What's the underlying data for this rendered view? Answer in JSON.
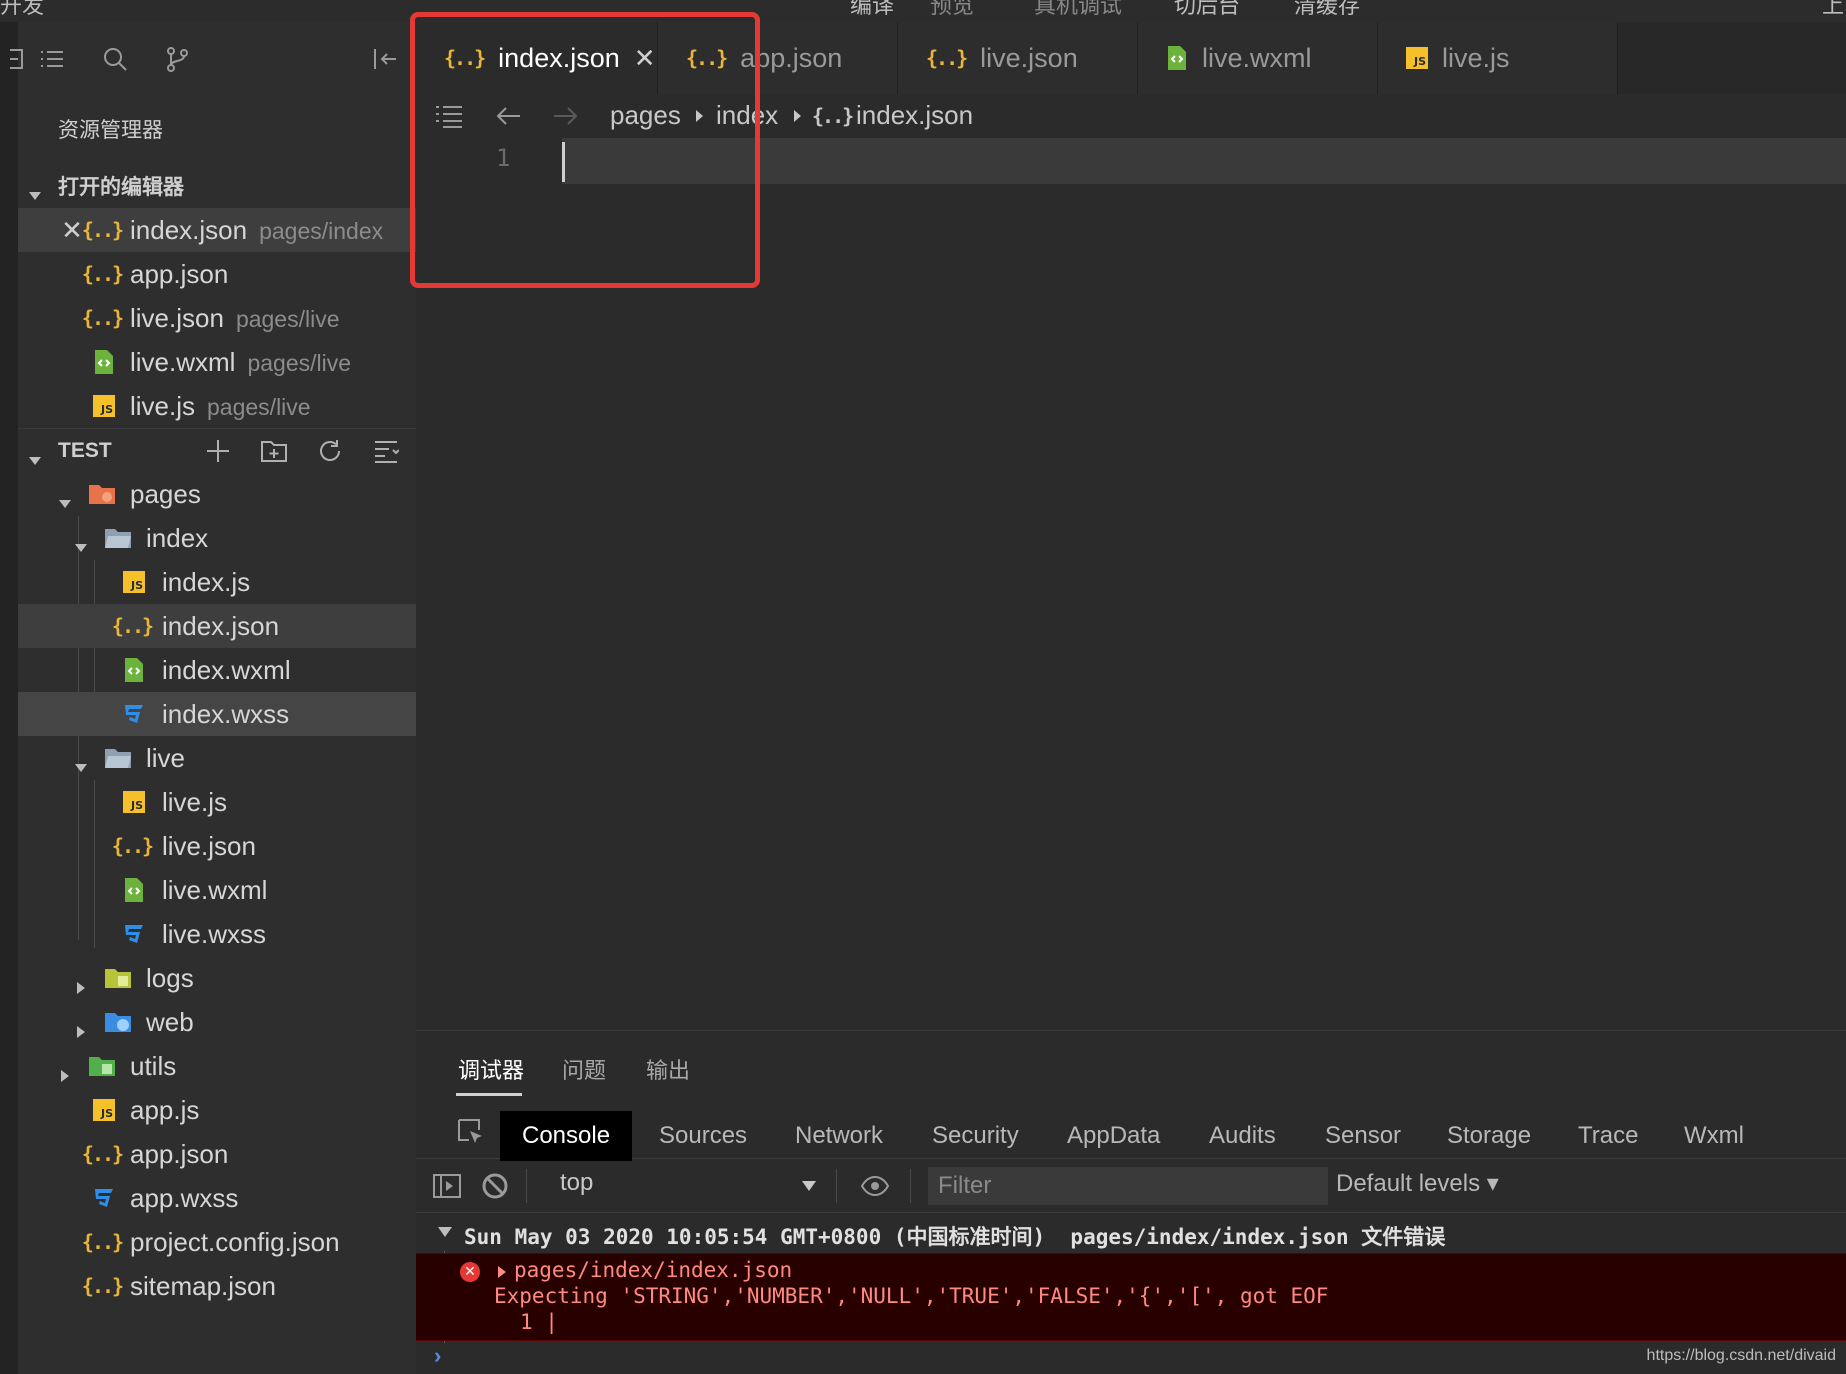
{
  "topbar": {
    "left_text": "开发",
    "items": [
      "编译",
      "预览",
      "真机调试",
      "切后台",
      "清缓存"
    ],
    "right_text": "上"
  },
  "sidebar": {
    "title": "资源管理器",
    "open_editors": {
      "header": "打开的编辑器",
      "items": [
        {
          "name": "index.json",
          "path": "pages/index",
          "type": "json"
        },
        {
          "name": "app.json",
          "path": "",
          "type": "json"
        },
        {
          "name": "live.json",
          "path": "pages/live",
          "type": "json"
        },
        {
          "name": "live.wxml",
          "path": "pages/live",
          "type": "wxml"
        },
        {
          "name": "live.js",
          "path": "pages/live",
          "type": "js"
        }
      ]
    },
    "project": {
      "header": "TEST",
      "tree": [
        {
          "name": "pages",
          "type": "folder-pages"
        },
        {
          "name": "index",
          "type": "folder"
        },
        {
          "name": "index.js",
          "type": "js"
        },
        {
          "name": "index.json",
          "type": "json"
        },
        {
          "name": "index.wxml",
          "type": "wxml"
        },
        {
          "name": "index.wxss",
          "type": "wxss"
        },
        {
          "name": "live",
          "type": "folder"
        },
        {
          "name": "live.js",
          "type": "js"
        },
        {
          "name": "live.json",
          "type": "json"
        },
        {
          "name": "live.wxml",
          "type": "wxml"
        },
        {
          "name": "live.wxss",
          "type": "wxss"
        },
        {
          "name": "logs",
          "type": "folder-logs"
        },
        {
          "name": "web",
          "type": "folder-web"
        },
        {
          "name": "utils",
          "type": "folder-utils"
        },
        {
          "name": "app.js",
          "type": "js"
        },
        {
          "name": "app.json",
          "type": "json"
        },
        {
          "name": "app.wxss",
          "type": "wxss"
        },
        {
          "name": "project.config.json",
          "type": "json"
        },
        {
          "name": "sitemap.json",
          "type": "json"
        }
      ]
    }
  },
  "tabs": [
    {
      "label": "index.json",
      "type": "json",
      "active": true
    },
    {
      "label": "app.json",
      "type": "json"
    },
    {
      "label": "live.json",
      "type": "json"
    },
    {
      "label": "live.wxml",
      "type": "wxml"
    },
    {
      "label": "live.js",
      "type": "js"
    }
  ],
  "breadcrumb": [
    "pages",
    "index",
    "index.json"
  ],
  "editor": {
    "line_number": "1"
  },
  "debugger": {
    "tabs": [
      "调试器",
      "问题",
      "输出"
    ],
    "devtools_tabs": [
      "Console",
      "Sources",
      "Network",
      "Security",
      "AppData",
      "Audits",
      "Sensor",
      "Storage",
      "Trace",
      "Wxml"
    ],
    "context": "top",
    "filter_placeholder": "Filter",
    "levels": "Default levels ▾",
    "log_header": "Sun May 03 2020 10:05:54 GMT+0800 (中国标准时间)  pages/index/index.json 文件错误",
    "error_path": "pages/index/index.json",
    "error_message": "Expecting 'STRING','NUMBER','NULL','TRUE','FALSE','{','[', got EOF",
    "error_line": "1 |",
    "prompt": "›",
    "watermark": "https://blog.csdn.net/divaid"
  },
  "colors": {
    "highlight": "#e53935",
    "json_icon": "#e8b43a",
    "js_icon": "#f5c02a",
    "wxml_icon": "#6cb33e",
    "wxss_icon": "#2f8fe8"
  }
}
